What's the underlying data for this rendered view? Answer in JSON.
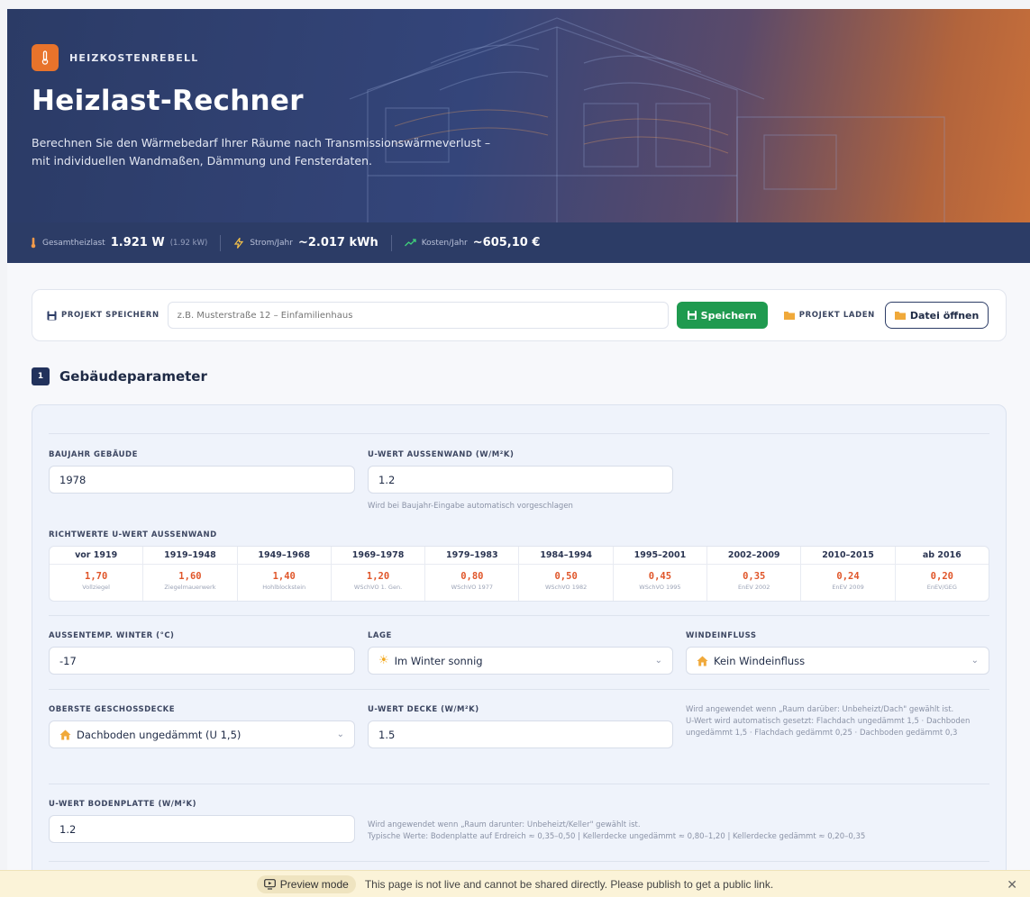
{
  "brand": {
    "name": "HEIZKOSTENREBELL"
  },
  "hero": {
    "title": "Heizlast-Rechner",
    "description": "Berechnen Sie den Wärmebedarf Ihrer Räume nach Transmissionswärmeverlust – mit individuellen Wandmaßen, Dämmung und Fensterdaten."
  },
  "stats": {
    "total_label": "Gesamtheizlast",
    "total_value": "1.921 W",
    "total_sub": "(1.92 kW)",
    "power_label": "Strom/Jahr",
    "power_value": "~2.017 kWh",
    "cost_label": "Kosten/Jahr",
    "cost_value": "~605,10 €"
  },
  "project": {
    "save_label": "PROJEKT SPEICHERN",
    "input_placeholder": "z.B. Musterstraße 12 – Einfamilienhaus",
    "save_button": "Speichern",
    "load_label": "PROJEKT LADEN",
    "open_button": "Datei öffnen"
  },
  "section": {
    "number": "1",
    "title": "Gebäudeparameter"
  },
  "fields": {
    "baujahr_label": "BAUJAHR GEBÄUDE",
    "baujahr_value": "1978",
    "uwand_label": "U-WERT AUSSENWAND (W/M²K)",
    "uwand_value": "1.2",
    "uwand_hint": "Wird bei Baujahr-Eingabe automatisch vorgeschlagen",
    "richtwerte_label": "RICHTWERTE U-WERT AUSSENWAND",
    "aussentemp_label": "AUSSENTEMP. WINTER (°C)",
    "aussentemp_value": "-17",
    "lage_label": "LAGE",
    "lage_value": "Im Winter sonnig",
    "wind_label": "WINDEINFLUSS",
    "wind_value": "Kein Windeinfluss",
    "decke_label": "OBERSTE GESCHOSSDECKE",
    "decke_value": "Dachboden ungedämmt (U 1,5)",
    "udecke_label": "U-WERT DECKE (W/M²K)",
    "udecke_value": "1.5",
    "decke_hint": "Wird angewendet wenn „Raum darüber: Unbeheizt/Dach\" gewählt ist.\nU-Wert wird automatisch gesetzt: Flachdach ungedämmt 1,5 · Dachboden ungedämmt 1,5 · Flachdach gedämmt 0,25 · Dachboden gedämmt 0,3",
    "uboden_label": "U-WERT BODENPLATTE (W/M²K)",
    "uboden_value": "1.2",
    "boden_hint": "Wird angewendet wenn „Raum darunter: Unbeheizt/Keller\" gewählt ist.\nTypische Werte: Bodenplatte auf Erdreich ≈ 0,35–0,50 | Kellerdecke ungedämmt ≈ 0,80–1,20 | Kellerdecke gedämmt ≈ 0,20–0,35"
  },
  "uvalues": [
    {
      "year": "vor 1919",
      "value": "1,70",
      "desc": "Vollziegel"
    },
    {
      "year": "1919–1948",
      "value": "1,60",
      "desc": "Ziegelmauerwerk"
    },
    {
      "year": "1949–1968",
      "value": "1,40",
      "desc": "Hohlblockstein"
    },
    {
      "year": "1969–1978",
      "value": "1,20",
      "desc": "WSchVO 1. Gen."
    },
    {
      "year": "1979–1983",
      "value": "0,80",
      "desc": "WSchVO 1977"
    },
    {
      "year": "1984–1994",
      "value": "0,50",
      "desc": "WSchVO 1982"
    },
    {
      "year": "1995–2001",
      "value": "0,45",
      "desc": "WSchVO 1995"
    },
    {
      "year": "2002–2009",
      "value": "0,35",
      "desc": "EnEV 2002"
    },
    {
      "year": "2010–2015",
      "value": "0,24",
      "desc": "EnEV 2009"
    },
    {
      "year": "ab 2016",
      "value": "0,20",
      "desc": "EnEV/GEG"
    }
  ],
  "banner": {
    "mode": "Preview mode",
    "text": "This page is not live and cannot be shared directly. Please publish to get a public link."
  },
  "colors": {
    "accent": "#e8732b",
    "navy": "#2c3c66",
    "save_green": "#1f9a4f",
    "uvalue_red": "#e0562a"
  }
}
